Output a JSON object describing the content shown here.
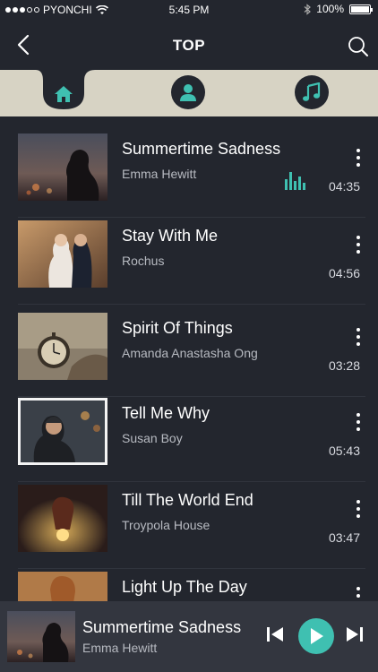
{
  "colors": {
    "background": "#23262e",
    "accent": "#3fc0b1",
    "tab_bar": "#d7d3c4",
    "player_bar": "#33363f"
  },
  "status_bar": {
    "carrier": "PYONCHI",
    "time": "5:45 PM",
    "battery": "100%"
  },
  "header": {
    "title": "TOP",
    "back_icon": "back-chevron-icon",
    "search_icon": "search-icon"
  },
  "tabs": [
    {
      "name": "home",
      "icon": "home-icon",
      "active": true
    },
    {
      "name": "artist",
      "icon": "person-icon",
      "active": false
    },
    {
      "name": "music",
      "icon": "music-note-icon",
      "active": false
    }
  ],
  "songs": [
    {
      "title": "Summertime Sadness",
      "artist": "Emma Hewitt",
      "duration": "04:35",
      "playing": true
    },
    {
      "title": "Stay With Me",
      "artist": "Rochus",
      "duration": "04:56",
      "playing": false
    },
    {
      "title": "Spirit Of Things",
      "artist": "Amanda Anastasha Ong",
      "duration": "03:28",
      "playing": false
    },
    {
      "title": "Tell Me Why",
      "artist": "Susan Boy",
      "duration": "05:43",
      "playing": false
    },
    {
      "title": "Till The World End",
      "artist": "Troypola House",
      "duration": "03:47",
      "playing": false
    },
    {
      "title": "Light Up The Day",
      "artist": "",
      "duration": "",
      "playing": false
    }
  ],
  "now_playing": {
    "title": "Summertime Sadness",
    "artist": "Emma Hewitt"
  }
}
